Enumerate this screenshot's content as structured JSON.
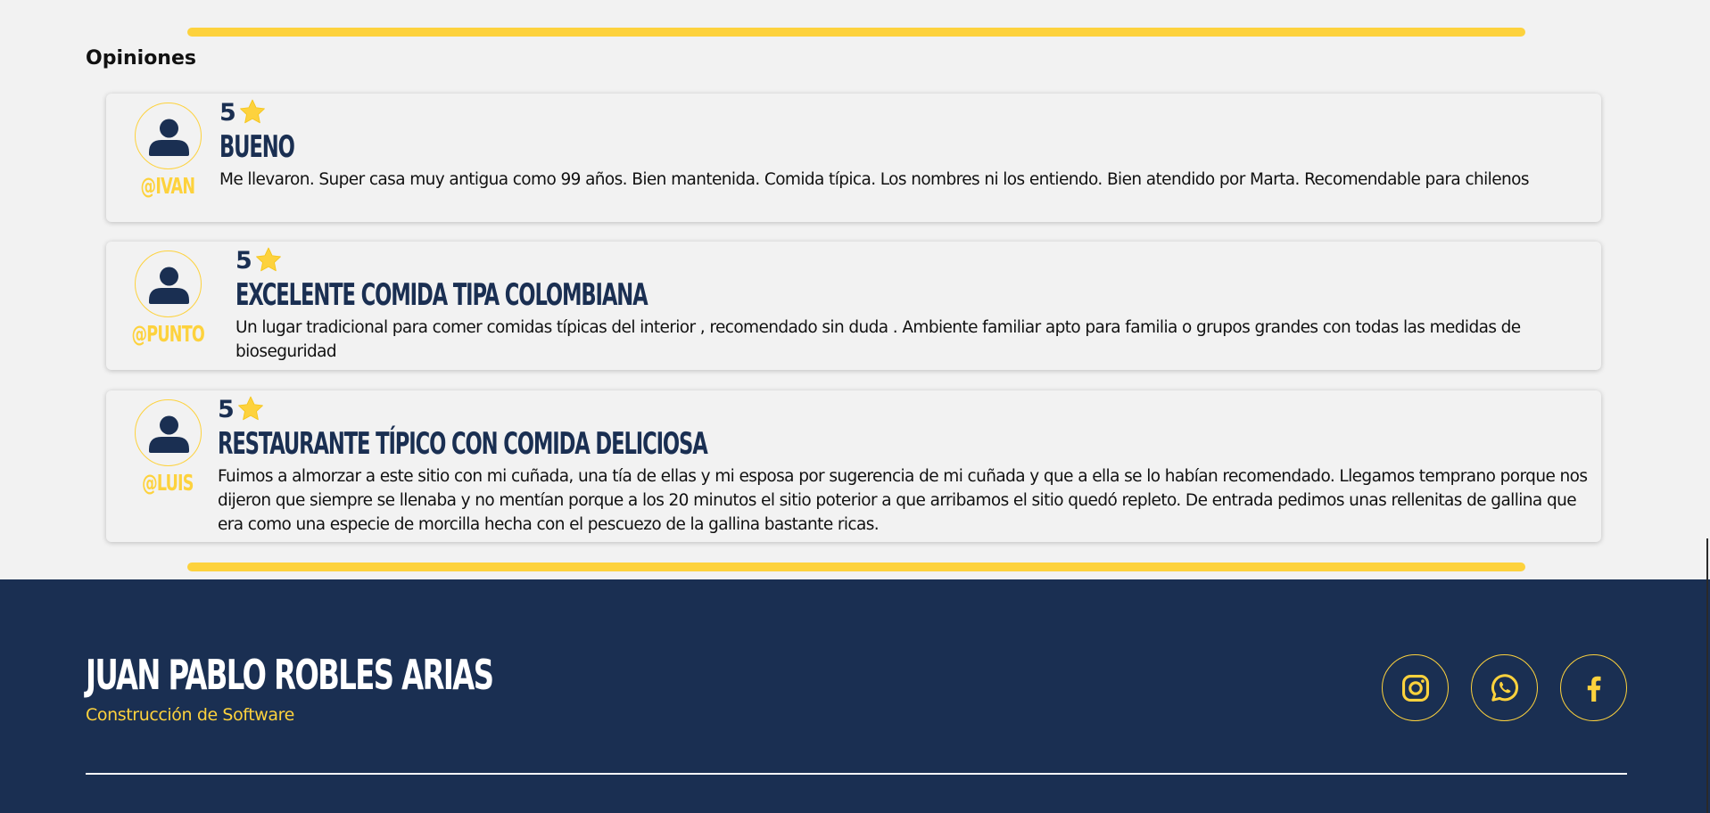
{
  "colors": {
    "accent": "#fdd23d",
    "navy": "#1a2f52",
    "background": "#f2f2f2"
  },
  "section": {
    "title": "Opiniones"
  },
  "reviews": [
    {
      "handle": "@IVAN",
      "rating": "5",
      "title": "BUENO",
      "text": "Me llevaron. Super casa muy antigua como 99 años. Bien mantenida. Comida típica. Los nombres ni los entiendo. Bien atendido por Marta. Recomendable para chilenos",
      "avatar_icon": "user-icon",
      "rating_icon": "star-icon"
    },
    {
      "handle": "@PUNTO",
      "rating": "5",
      "title": "EXCELENTE COMIDA TIPA COLOMBIANA",
      "text": "Un lugar tradicional para comer comidas típicas del interior , recomendado sin duda . Ambiente familiar apto para familia o grupos grandes con todas las medidas de bioseguridad",
      "avatar_icon": "user-icon",
      "rating_icon": "star-icon"
    },
    {
      "handle": "@LUIS",
      "rating": "5",
      "title": "RESTAURANTE TÍPICO CON COMIDA DELICIOSA",
      "text": "Fuimos a almorzar a este sitio con mi cuñada, una tía de ellas y mi esposa por sugerencia de mi cuñada y que a ella se lo habían recomendado. Llegamos temprano porque nos dijeron que siempre se llenaba y no mentían porque a los 20 minutos el sitio poterior a que arribamos el sitio quedó repleto. De entrada pedimos unas rellenitas de gallina que era como una especie de morcilla hecha con el pescuezo de la gallina bastante ricas.",
      "avatar_icon": "user-icon",
      "rating_icon": "star-icon"
    }
  ],
  "footer": {
    "name": "JUAN PABLO ROBLES ARIAS",
    "subtitle": "Construcción de Software",
    "social": [
      {
        "icon": "instagram-icon"
      },
      {
        "icon": "whatsapp-icon"
      },
      {
        "icon": "facebook-icon"
      }
    ]
  }
}
